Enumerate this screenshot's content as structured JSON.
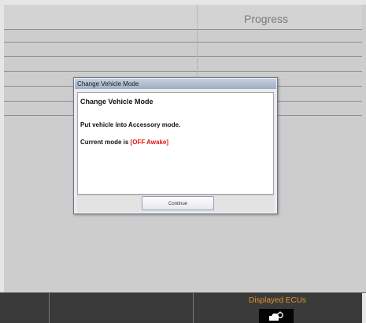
{
  "header": {
    "progress_label": "Progress"
  },
  "dialog": {
    "title": "Change Vehicle Mode",
    "heading": "Change Vehicle Mode",
    "instruction": "Put vehicle into Accessory mode.",
    "current_mode_prefix": "Current mode is ",
    "current_mode_value": "[OFF Awake]",
    "continue_label": "Continue"
  },
  "footer": {
    "displayed_ecus_label": "Displayed ECUs",
    "ecu_icon": "vehicle-connector-icon"
  },
  "colors": {
    "mode_value": "#e21212",
    "footer_label": "#e2942c",
    "footer_background": "#3a3a3a"
  }
}
